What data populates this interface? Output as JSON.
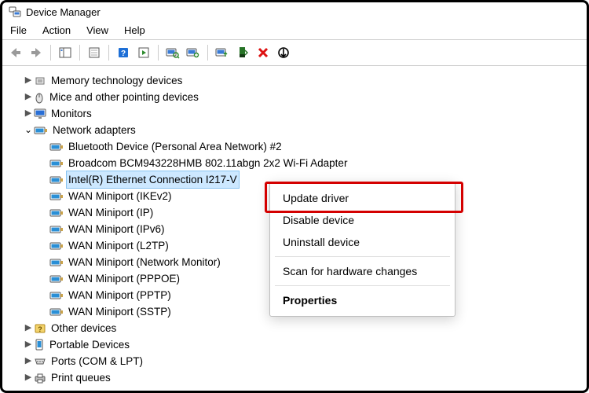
{
  "window": {
    "title": "Device Manager"
  },
  "menu": {
    "file": "File",
    "action": "Action",
    "view": "View",
    "help": "Help"
  },
  "tree": {
    "memory": "Memory technology devices",
    "mice": "Mice and other pointing devices",
    "monitors": "Monitors",
    "netadapters": "Network adapters",
    "bt": "Bluetooth Device (Personal Area Network) #2",
    "broadcom": "Broadcom BCM943228HMB 802.11abgn 2x2 Wi-Fi Adapter",
    "intel": "Intel(R) Ethernet Connection I217-V",
    "ikev2": "WAN Miniport (IKEv2)",
    "ip": "WAN Miniport (IP)",
    "ipv6": "WAN Miniport (IPv6)",
    "l2tp": "WAN Miniport (L2TP)",
    "netmon": "WAN Miniport (Network Monitor)",
    "pppoe": "WAN Miniport (PPPOE)",
    "pptp": "WAN Miniport (PPTP)",
    "sstp": "WAN Miniport (SSTP)",
    "other": "Other devices",
    "portable": "Portable Devices",
    "ports": "Ports (COM & LPT)",
    "print": "Print queues"
  },
  "ctx": {
    "update": "Update driver",
    "disable": "Disable device",
    "uninstall": "Uninstall device",
    "scan": "Scan for hardware changes",
    "props": "Properties"
  }
}
